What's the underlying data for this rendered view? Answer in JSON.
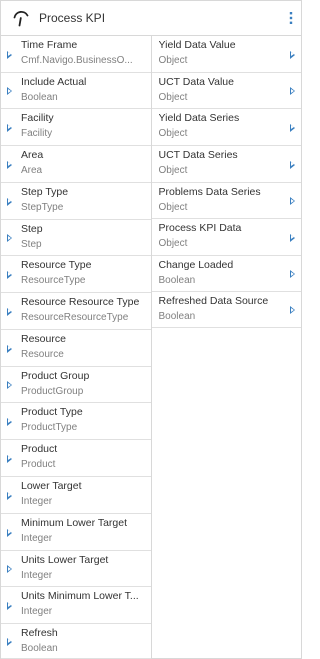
{
  "header": {
    "title": "Process KPI",
    "icon": "gauge-icon",
    "menu_icon": "more-vertical-icon"
  },
  "inputs": [
    {
      "name": "Time Frame",
      "type": "Cmf.Navigo.BusinessO..."
    },
    {
      "name": "Include Actual",
      "type": "Boolean"
    },
    {
      "name": "Facility",
      "type": "Facility"
    },
    {
      "name": "Area",
      "type": "Area"
    },
    {
      "name": "Step Type",
      "type": "StepType"
    },
    {
      "name": "Step",
      "type": "Step"
    },
    {
      "name": "Resource Type",
      "type": "ResourceType"
    },
    {
      "name": "Resource Resource Type",
      "type": "ResourceResourceType"
    },
    {
      "name": "Resource",
      "type": "Resource"
    },
    {
      "name": "Product Group",
      "type": "ProductGroup"
    },
    {
      "name": "Product Type",
      "type": "ProductType"
    },
    {
      "name": "Product",
      "type": "Product"
    },
    {
      "name": "Lower Target",
      "type": "Integer"
    },
    {
      "name": "Minimum Lower Target",
      "type": "Integer"
    },
    {
      "name": "Units Lower Target",
      "type": "Integer"
    },
    {
      "name": "Units Minimum Lower T...",
      "type": "Integer"
    },
    {
      "name": "Refresh",
      "type": "Boolean"
    }
  ],
  "outputs": [
    {
      "name": "Yield Data Value",
      "type": "Object"
    },
    {
      "name": "UCT Data Value",
      "type": "Object"
    },
    {
      "name": "Yield Data Series",
      "type": "Object"
    },
    {
      "name": "UCT Data Series",
      "type": "Object"
    },
    {
      "name": "Problems Data Series",
      "type": "Object"
    },
    {
      "name": "Process KPI Data",
      "type": "Object"
    },
    {
      "name": "Change Loaded",
      "type": "Boolean"
    },
    {
      "name": "Refreshed Data Source",
      "type": "Boolean"
    }
  ],
  "colors": {
    "port_arrow": "#3a7fc0",
    "border": "#d8d8d8",
    "text": "#333333",
    "subtext": "#808080"
  }
}
